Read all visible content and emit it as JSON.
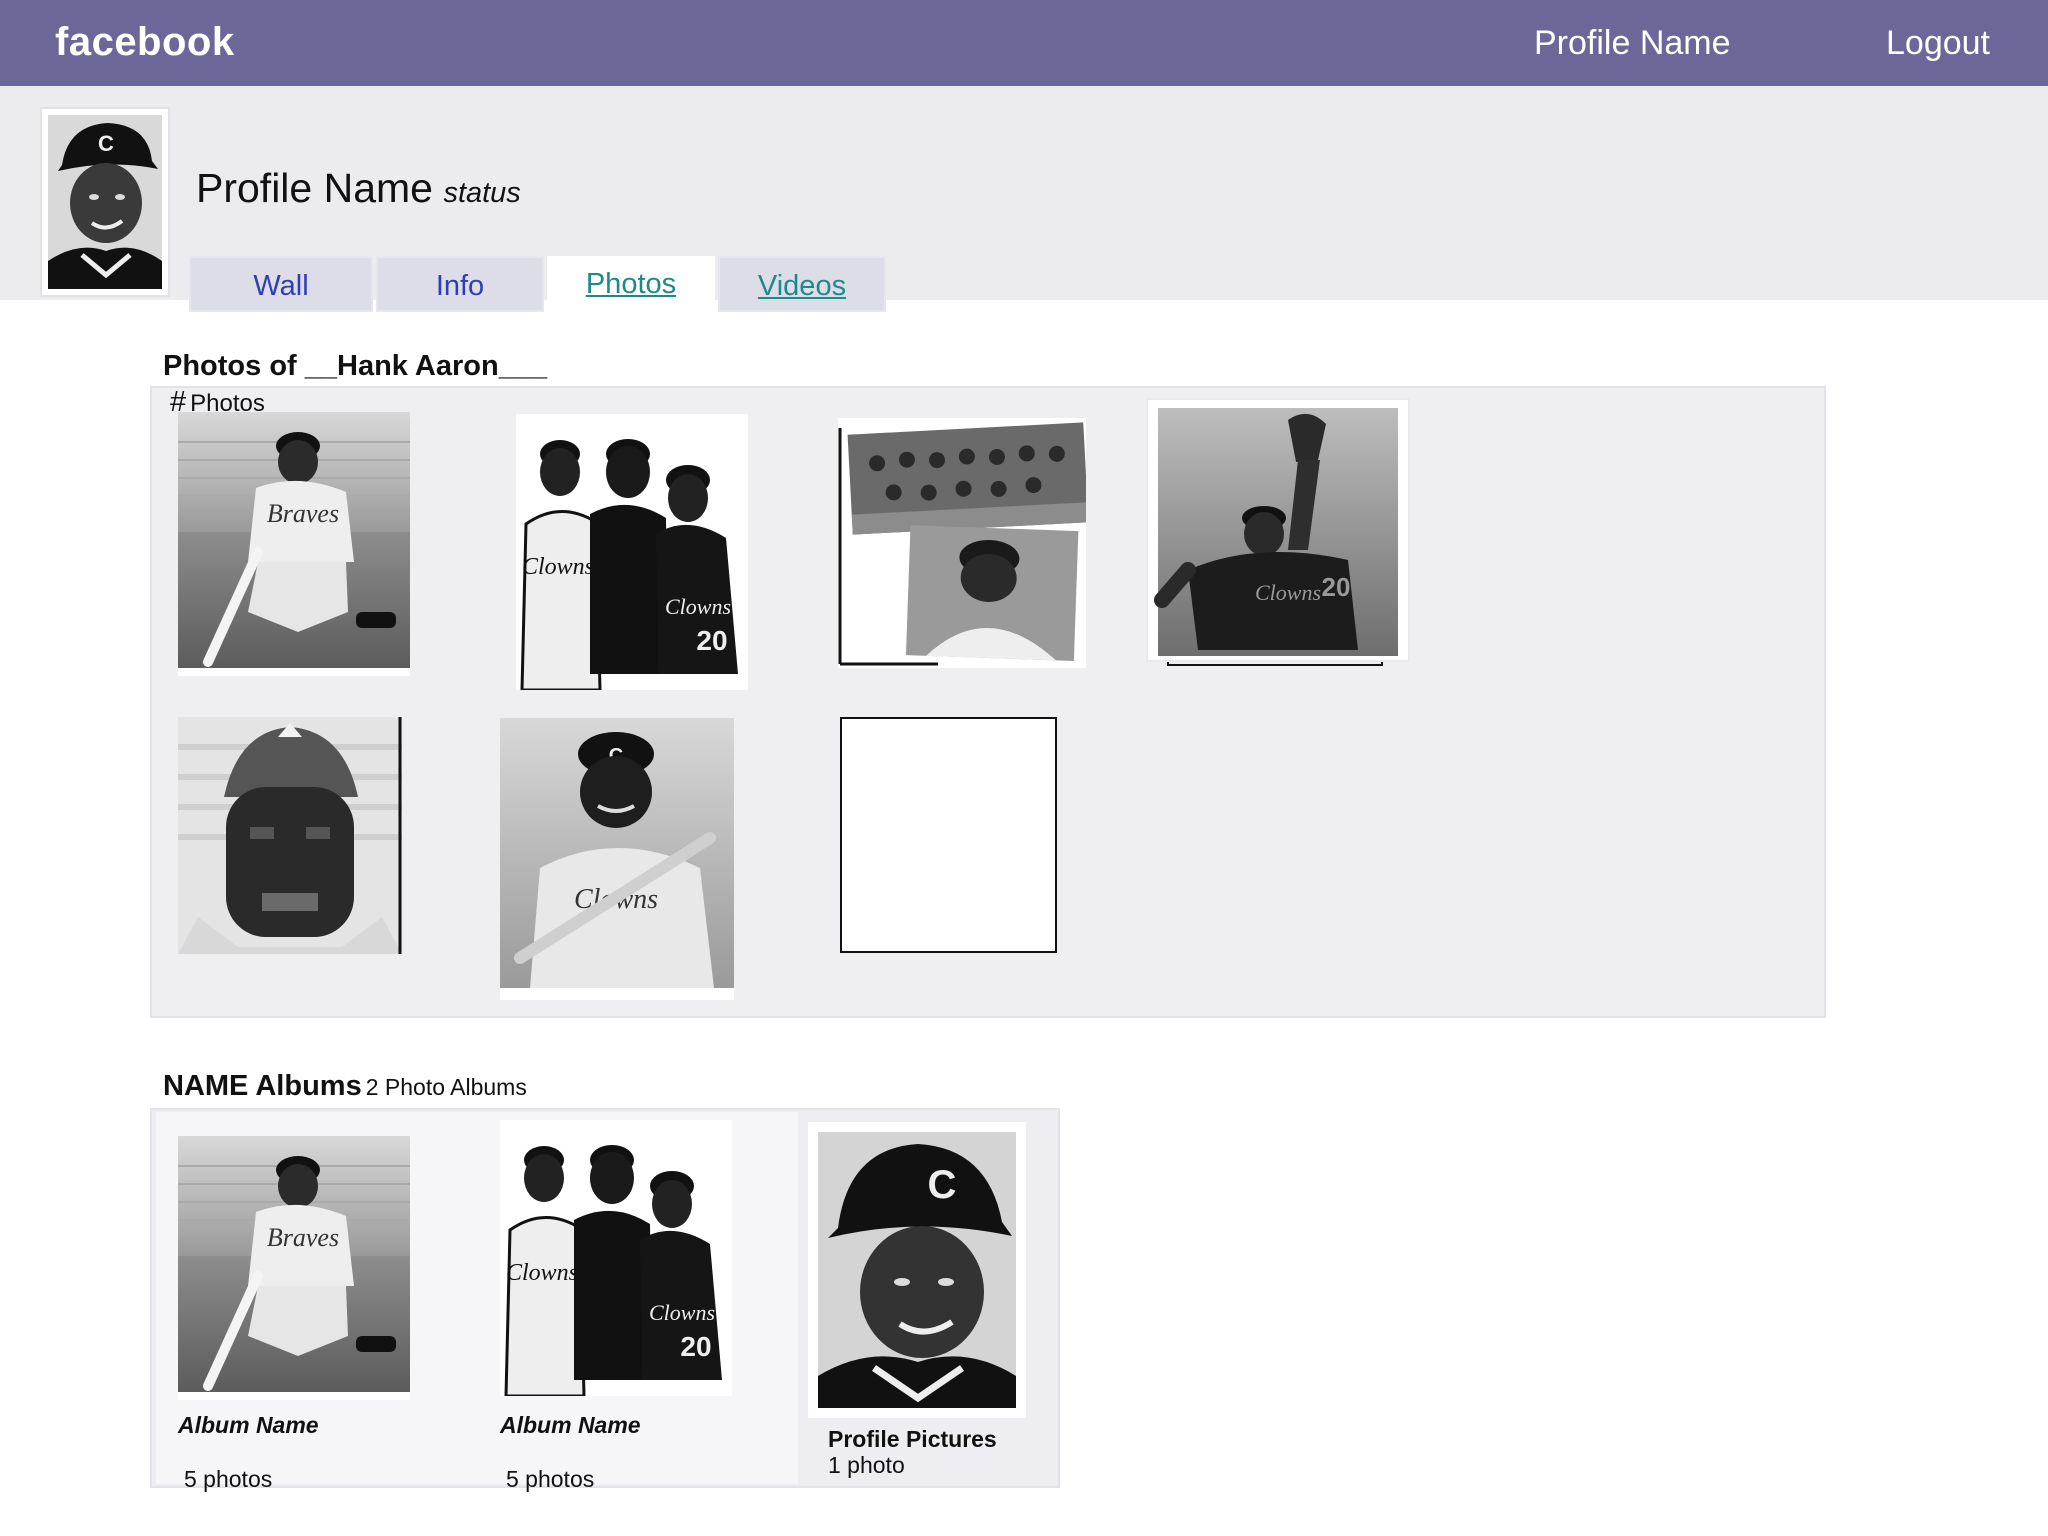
{
  "topbar": {
    "brand": "facebook",
    "profile_link": "Profile Name",
    "logout": "Logout"
  },
  "profile": {
    "name": "Profile Name",
    "status": "status"
  },
  "tabs": [
    {
      "label": "Wall"
    },
    {
      "label": "Info"
    },
    {
      "label": "Photos",
      "active": true
    },
    {
      "label": "Videos"
    }
  ],
  "photos": {
    "title": "Photos of __Hank Aaron___",
    "count_hash": "#",
    "count_label": "Photos"
  },
  "albums": {
    "title": "NAME Albums",
    "subtitle": "2 Photo Albums",
    "items": [
      {
        "name": "Album Name",
        "count": "5 photos"
      },
      {
        "name": "Album Name",
        "count": "5 photos"
      },
      {
        "name": "Profile Pictures",
        "count": "1 photo"
      }
    ]
  },
  "colors": {
    "topbar": "#6b6899",
    "header_band": "#ececee",
    "tab_inactive": "#dcdde6",
    "tab_link_blue": "#2f3fb3",
    "tab_link_teal": "#1d8a8a",
    "panel": "#efeff2"
  }
}
